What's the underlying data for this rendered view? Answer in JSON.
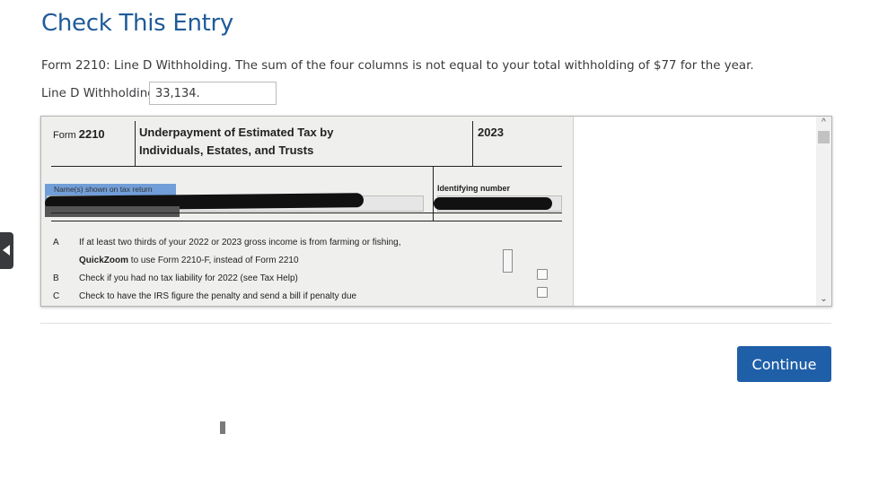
{
  "page": {
    "title": "Check This Entry",
    "message": "Form 2210: Line D Withholding. The sum of the four columns is not equal to your total withholding of $77 for the year."
  },
  "field": {
    "label": "Line D Withholding",
    "value": "33,134."
  },
  "form": {
    "form_label": "Form",
    "form_number": "2210",
    "title_line1": "Underpayment of Estimated Tax by",
    "title_line2": "Individuals, Estates, and Trusts",
    "year": "2023",
    "names_label": "Name(s) shown on tax return",
    "id_label": "Identifying number",
    "rows": [
      {
        "letter": "A",
        "text": "If at least two thirds of your 2022 or 2023 gross income is from farming or fishing,"
      },
      {
        "letter": "",
        "text_bold": "QuickZoom",
        "text": " to use Form 2210-F, instead of Form 2210"
      },
      {
        "letter": "B",
        "text": "Check if you had no tax liability for 2022 (see Tax Help)"
      },
      {
        "letter": "C",
        "text": "Check to have the IRS figure the penalty and send a bill if penalty due"
      }
    ]
  },
  "actions": {
    "continue_label": "Continue"
  },
  "colors": {
    "title": "#1f5b99",
    "button": "#1f5fa8"
  },
  "icons": {
    "scroll_up": "chevron-up-icon",
    "scroll_down": "chevron-down-icon",
    "side_tab": "triangle-left-icon"
  }
}
